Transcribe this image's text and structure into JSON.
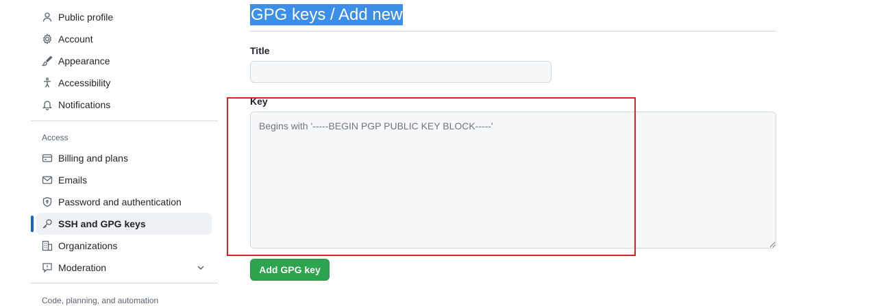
{
  "sidebar": {
    "items": [
      {
        "label": "Public profile",
        "icon": "person-icon"
      },
      {
        "label": "Account",
        "icon": "gear-icon"
      },
      {
        "label": "Appearance",
        "icon": "paintbrush-icon"
      },
      {
        "label": "Accessibility",
        "icon": "accessibility-icon"
      },
      {
        "label": "Notifications",
        "icon": "bell-icon"
      }
    ],
    "access_heading": "Access",
    "access_items": [
      {
        "label": "Billing and plans",
        "icon": "credit-card-icon"
      },
      {
        "label": "Emails",
        "icon": "mail-icon"
      },
      {
        "label": "Password and authentication",
        "icon": "shield-lock-icon"
      },
      {
        "label": "SSH and GPG keys",
        "icon": "key-icon",
        "active": true
      },
      {
        "label": "Organizations",
        "icon": "organization-icon"
      },
      {
        "label": "Moderation",
        "icon": "report-icon",
        "expandable": true
      }
    ],
    "code_heading": "Code, planning, and automation"
  },
  "main": {
    "title": "GPG keys / Add new",
    "title_field_label": "Title",
    "title_value": "",
    "key_field_label": "Key",
    "key_value": "",
    "key_placeholder": "Begins with '-----BEGIN PGP PUBLIC KEY BLOCK-----'",
    "submit_label": "Add GPG key"
  },
  "colors": {
    "accent": "#0969da",
    "primary_button": "#2da44e",
    "title_highlight": "#3b8fe8",
    "annotation": "#e0201b"
  }
}
